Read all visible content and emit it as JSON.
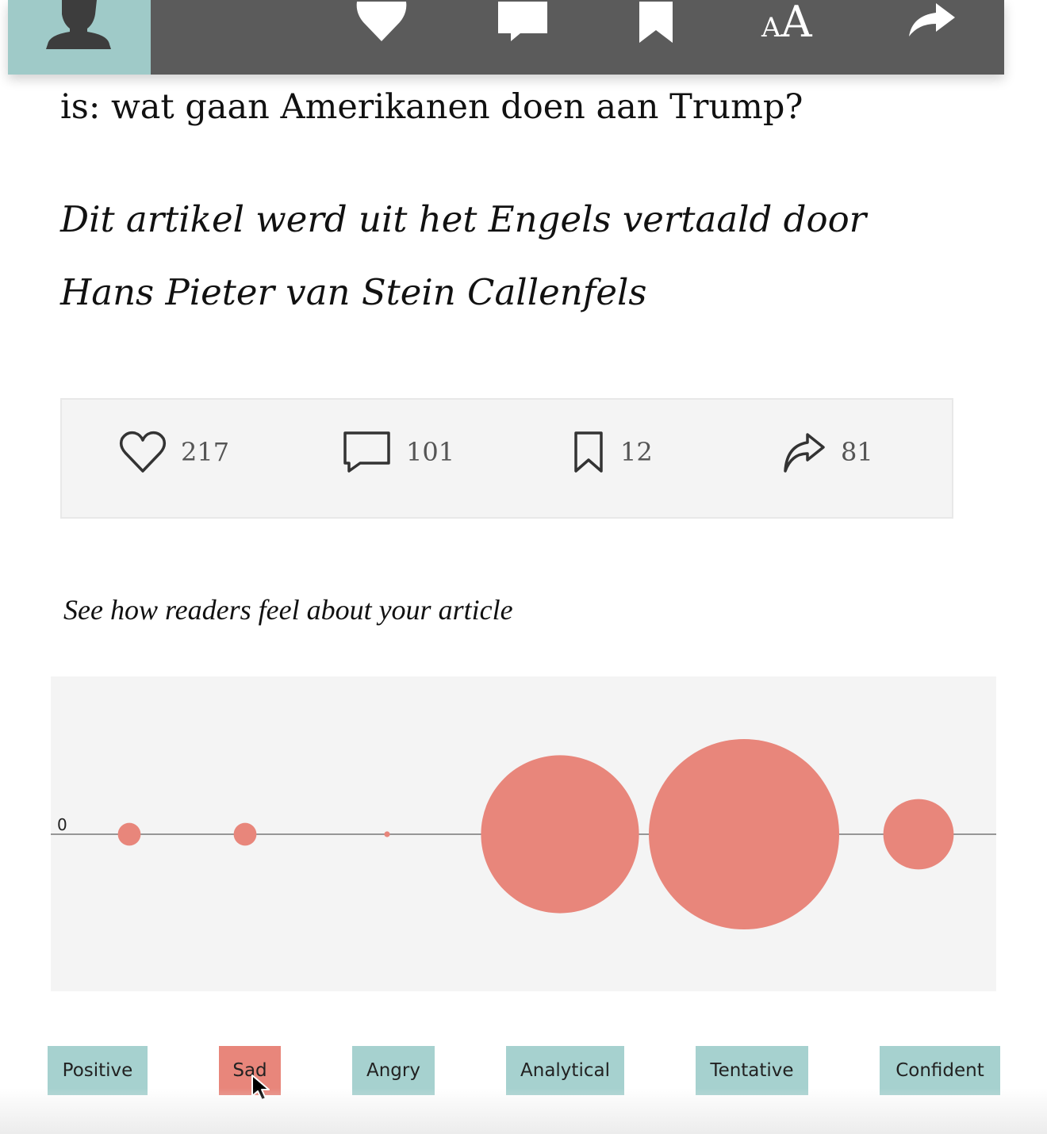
{
  "toolbar": {
    "icons": [
      "user-icon",
      "heart-icon",
      "comment-icon",
      "bookmark-icon",
      "font-size-icon",
      "share-icon"
    ],
    "font_small": "A",
    "font_big": "A",
    "accent": "#9fcac8",
    "background": "#5b5b5b"
  },
  "article": {
    "line1": "is: wat gaan Amerikanen doen aan Trump?",
    "credit_line1": "Dit artikel werd uit het Engels vertaald door",
    "credit_line2": "Hans Pieter van Stein Callenfels"
  },
  "stats": {
    "likes": "217",
    "comments": "101",
    "bookmarks": "12",
    "shares": "81"
  },
  "prompt": "See how readers feel about your article",
  "chart_data": {
    "type": "scatter",
    "baseline_label": "0",
    "categories": [
      "Positive",
      "Sad",
      "Angry",
      "Analytical",
      "Tentative",
      "Confident"
    ],
    "sizes": [
      0.12,
      0.12,
      0.03,
      0.83,
      1.0,
      0.37
    ],
    "color": "#e8867b",
    "grid": false
  },
  "tones": {
    "buttons": [
      "Positive",
      "Sad",
      "Angry",
      "Analytical",
      "Tentative",
      "Confident"
    ],
    "selected": "Sad",
    "color": "#a6d1cf",
    "selected_color": "#e8867b"
  }
}
